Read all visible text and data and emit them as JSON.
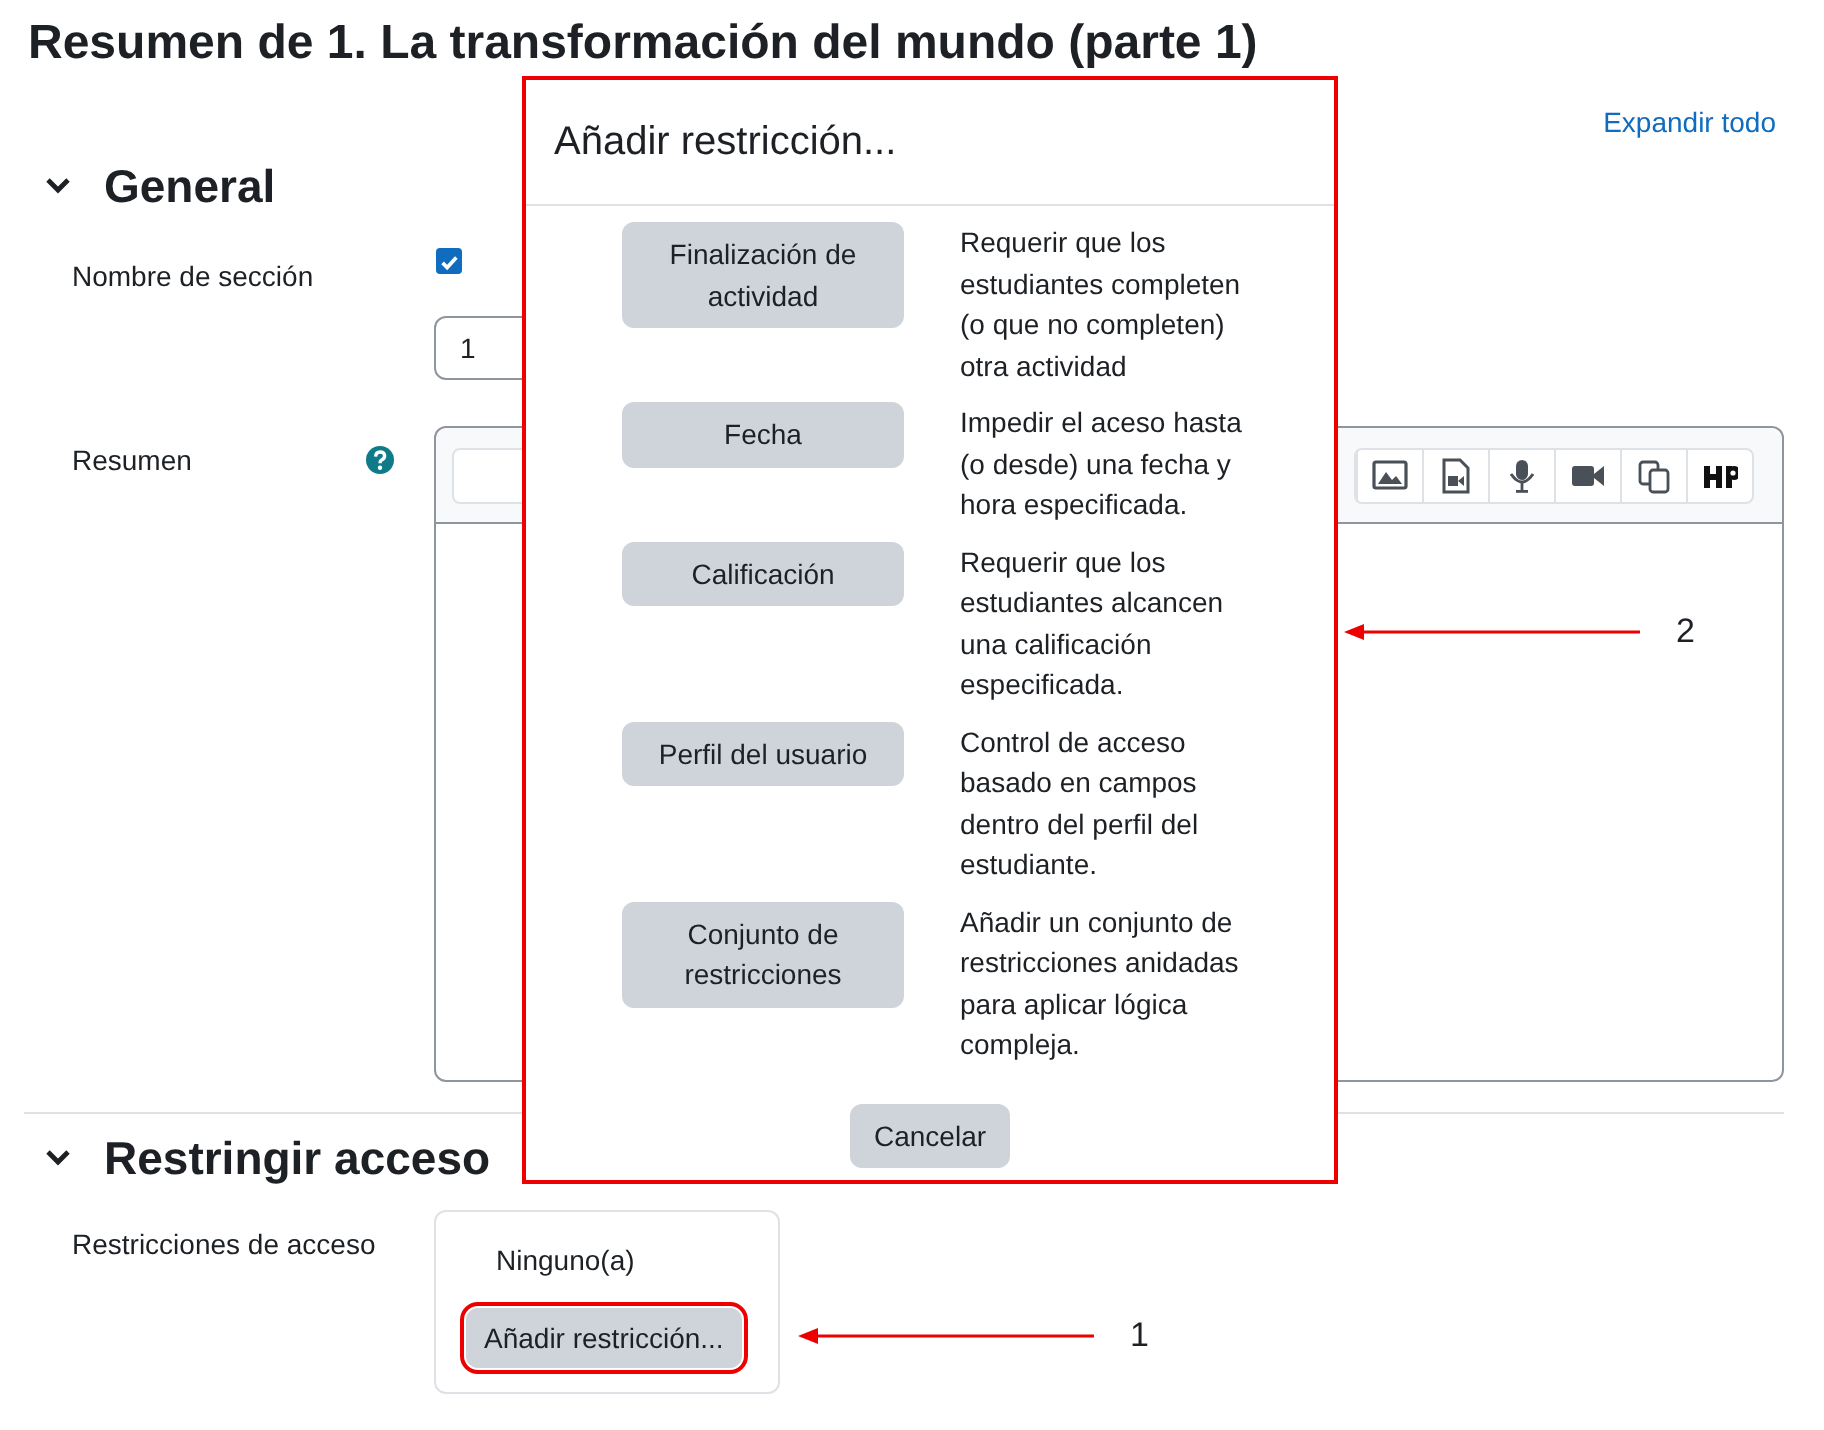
{
  "page_title": "Resumen de 1. La transformación del mundo (parte 1)",
  "expand_all": "Expandir todo",
  "sections": [
    {
      "heading": "General",
      "expanded": true,
      "fields": [
        {
          "kind": "name",
          "label": "Nombre de sección",
          "checked": true,
          "value": "1"
        },
        {
          "kind": "editor",
          "label": "Resumen"
        }
      ]
    },
    {
      "heading": "Restringir acceso",
      "expanded": true,
      "fields": [
        {
          "kind": "restrictions",
          "label": "Restricciones de acceso",
          "status": "Ninguno(a)",
          "button": "Añadir restricción..."
        }
      ]
    }
  ],
  "dialog": {
    "title": "Añadir restricción...",
    "options": [
      {
        "label": "Finalización de actividad",
        "description": "Requerir que los estudiantes completen (o que no completen) otra actividad"
      },
      {
        "label": "Fecha",
        "description": "Impedir el aceso hasta (o desde) una fecha y hora especificada."
      },
      {
        "label": "Calificación",
        "description": "Requerir que los estudiantes alcancen una calificación especificada."
      },
      {
        "label": "Perfil del usuario",
        "description": "Control de acceso basado en campos dentro del perfil del estudiante."
      },
      {
        "label": "Conjunto de restricciones",
        "description": "Añadir un conjunto de restricciones anidadas para aplicar lógica compleja."
      }
    ],
    "cancel": "Cancelar"
  },
  "callouts": [
    {
      "label": "1"
    },
    {
      "label": "2"
    }
  ]
}
